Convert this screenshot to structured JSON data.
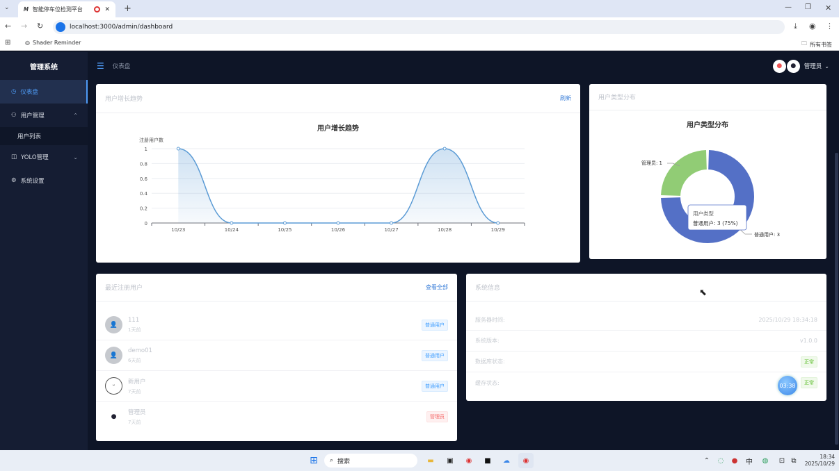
{
  "browser": {
    "tab_title": "智能停车位检测平台",
    "url": "localhost:3000/admin/dashboard",
    "bookmark": "Shader Reminder",
    "all_bookmarks": "所有书签"
  },
  "sidebar": {
    "title": "管理系统",
    "items": [
      {
        "label": "仪表盘",
        "icon": "dashboard-icon"
      },
      {
        "label": "用户管理",
        "icon": "user-icon"
      },
      {
        "label": "用户列表"
      },
      {
        "label": "YOLO管理",
        "icon": "camera-icon"
      },
      {
        "label": "系统设置",
        "icon": "gear-icon"
      }
    ]
  },
  "header": {
    "breadcrumb": "仪表盘",
    "user_name": "管理员"
  },
  "growth_card": {
    "title": "用户增长趋势",
    "action": "刷新"
  },
  "chart_data": [
    {
      "type": "area",
      "title": "用户增长趋势",
      "ylabel": "注册用户数",
      "x": [
        "10/23",
        "10/24",
        "10/25",
        "10/26",
        "10/27",
        "10/28",
        "10/29"
      ],
      "y_ticks": [
        "0",
        "0.2",
        "0.4",
        "0.6",
        "0.8",
        "1"
      ],
      "ylim": [
        0,
        1
      ],
      "values": [
        1,
        0,
        0,
        0,
        0,
        1,
        0
      ],
      "color": "#5b9bd5"
    },
    {
      "type": "pie",
      "title": "用户类型分布",
      "slices": [
        {
          "label": "普通用户",
          "value": 3,
          "color": "#5470c6"
        },
        {
          "label": "管理员",
          "value": 1,
          "color": "#91cc75"
        }
      ],
      "slice_labels": [
        "管理员: 1",
        "普通用户: 3"
      ],
      "tooltip": {
        "title": "用户类型",
        "text": "普通用户: 3 (75%)"
      }
    }
  ],
  "pie_card": {
    "title": "用户类型分布"
  },
  "recent_users": {
    "title": "最近注册用户",
    "action": "查看全部",
    "users": [
      {
        "name": "111",
        "time": "1天前",
        "role": "普通用户"
      },
      {
        "name": "demo01",
        "time": "6天前",
        "role": "普通用户"
      },
      {
        "name": "新用户",
        "time": "7天前",
        "role": "普通用户"
      },
      {
        "name": "管理员",
        "time": "7天前",
        "role": "管理员"
      }
    ]
  },
  "system_info": {
    "title": "系统信息",
    "rows": [
      {
        "label": "服务器时间:",
        "value": "2025/10/29 18:34:18"
      },
      {
        "label": "系统版本:",
        "value": "v1.0.0"
      },
      {
        "label": "数据库状态:",
        "value": "正常"
      },
      {
        "label": "缓存状态:",
        "value": "正常"
      }
    ],
    "float_badge": "03:38"
  },
  "taskbar": {
    "search": "搜索",
    "ime": "中",
    "time": "18:34",
    "date": "2025/10/29"
  }
}
